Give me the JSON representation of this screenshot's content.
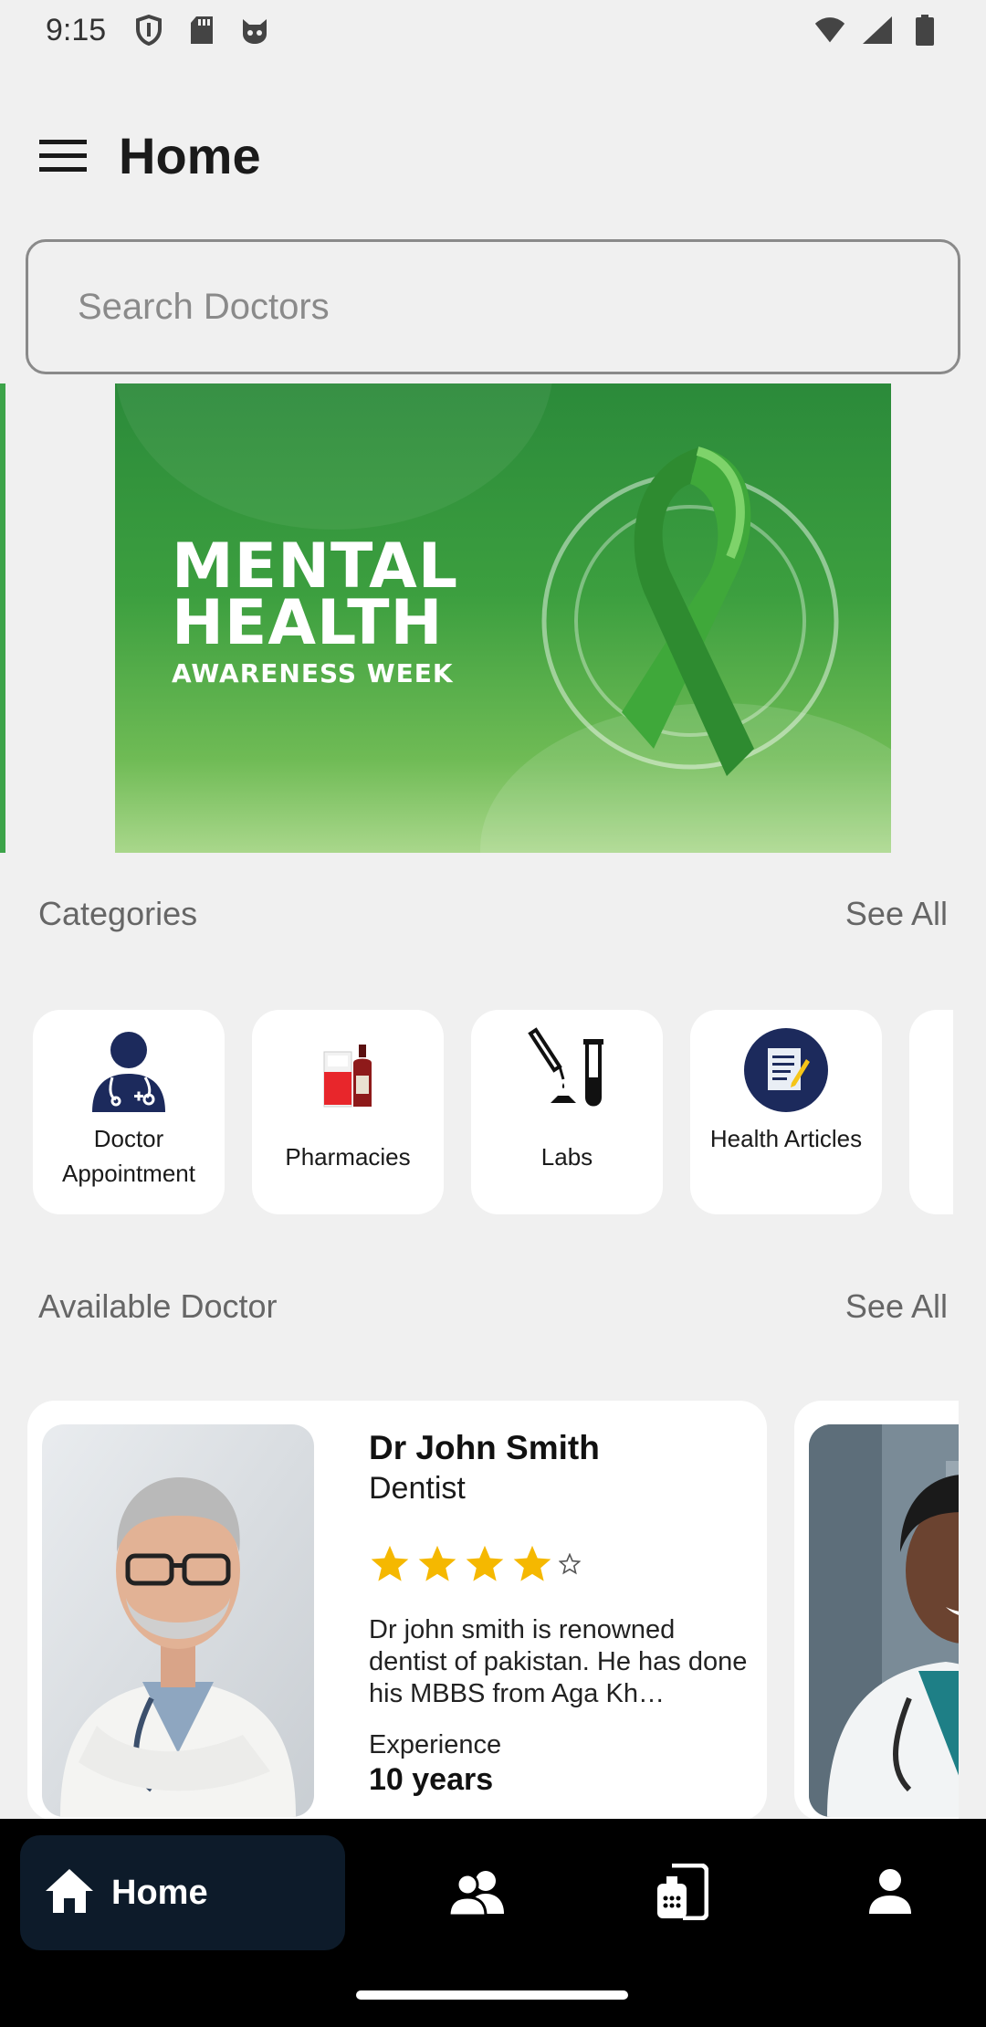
{
  "status_bar": {
    "time": "9:15",
    "left_icons": [
      "shield-icon",
      "sd-card-icon",
      "cat-face-icon"
    ],
    "right_icons": [
      "wifi-icon",
      "cell-signal-icon",
      "battery-icon"
    ]
  },
  "app_bar": {
    "menu_icon": "hamburger-menu-icon",
    "title": "Home"
  },
  "search": {
    "placeholder": "Search Doctors",
    "value": ""
  },
  "banner": {
    "line1": "MENTAL",
    "line2": "HEALTH",
    "line3": "AWARENESS WEEK"
  },
  "categories_section": {
    "title": "Categories",
    "see_all": "See All",
    "items": [
      {
        "label": "Doctor Appointment",
        "icon": "doctor-icon"
      },
      {
        "label": "Pharmacies",
        "icon": "medicine-bottles-icon"
      },
      {
        "label": "Labs",
        "icon": "test-tube-icon"
      },
      {
        "label": "Health Articles",
        "icon": "article-icon"
      }
    ]
  },
  "doctors_section": {
    "title": "Available Doctor",
    "see_all": "See All",
    "doctors": [
      {
        "name": "Dr John Smith",
        "specialty": "Dentist",
        "rating": 4,
        "rating_max": 5,
        "bio": "Dr john smith is renowned dentist of pakistan. He has done his MBBS from Aga Kh…",
        "experience_label": "Experience",
        "experience_value": "10 years"
      }
    ]
  },
  "bottom_nav": {
    "items": [
      {
        "label": "Home",
        "icon": "home-icon",
        "active": true
      },
      {
        "label": "",
        "icon": "people-icon",
        "active": false
      },
      {
        "label": "",
        "icon": "medical-records-icon",
        "active": false
      },
      {
        "label": "",
        "icon": "profile-icon",
        "active": false
      }
    ]
  },
  "colors": {
    "background": "#f0f0f0",
    "star": "#f5b800",
    "nav_active": "#0d1b2a",
    "banner_green": "#3c9f3f"
  }
}
